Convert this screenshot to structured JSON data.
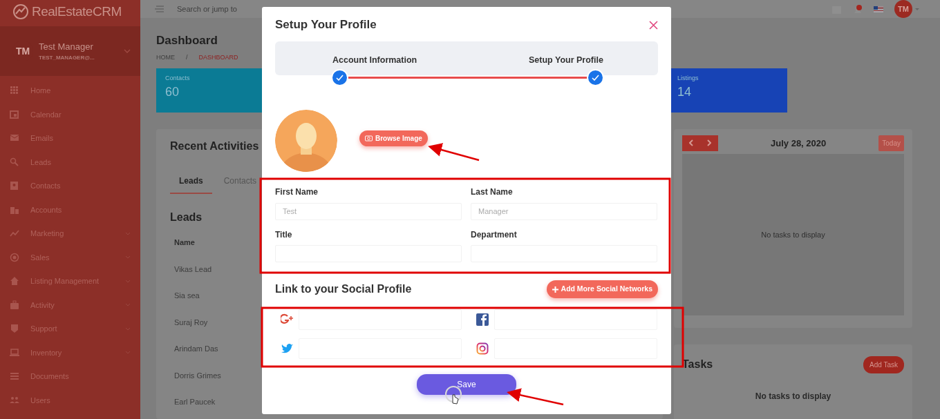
{
  "sidebar": {
    "logo": "RealEstateCRM",
    "user": {
      "initials": "TM",
      "name": "Test Manager",
      "email": "TEST_MANAGER@..."
    },
    "items": [
      {
        "label": "Home",
        "expandable": false
      },
      {
        "label": "Calendar",
        "expandable": false
      },
      {
        "label": "Emails",
        "expandable": false
      },
      {
        "label": "Leads",
        "expandable": false
      },
      {
        "label": "Contacts",
        "expandable": false
      },
      {
        "label": "Accounts",
        "expandable": false
      },
      {
        "label": "Marketing",
        "expandable": true
      },
      {
        "label": "Sales",
        "expandable": true
      },
      {
        "label": "Listing Management",
        "expandable": true
      },
      {
        "label": "Activity",
        "expandable": true
      },
      {
        "label": "Support",
        "expandable": true
      },
      {
        "label": "Inventory",
        "expandable": true
      },
      {
        "label": "Documents",
        "expandable": false
      },
      {
        "label": "Users",
        "expandable": false
      }
    ]
  },
  "topbar": {
    "search": {
      "placeholder": "Search or jump to"
    },
    "avatar": "TM"
  },
  "page": {
    "title": "Dashboard",
    "breadcrumb": [
      "HOME",
      "DASHBOARD"
    ],
    "breadcrumb_separator": "/",
    "stats": [
      {
        "label": "Contacts",
        "value": "60",
        "color": "#0b7b95"
      },
      {
        "label": "Listings",
        "value": "14",
        "color": "#1743b5"
      }
    ]
  },
  "activities": {
    "title": "Recent Activities",
    "tabs": [
      {
        "label": "Leads",
        "selected": true
      },
      {
        "label": "Contacts",
        "selected": false
      }
    ],
    "section": "Leads",
    "column": "Name",
    "rows": [
      "Vikas Lead",
      "Sia sea",
      "Suraj Roy",
      "Arindam Das",
      "Dorris Grimes",
      "Earl Paucek"
    ]
  },
  "calendar": {
    "date": "July 28, 2020",
    "today_button": "Today",
    "empty": "No tasks to display"
  },
  "tasks": {
    "title": "Tasks",
    "button": "Add Task",
    "empty": "No tasks to display"
  },
  "modal": {
    "title": "Setup Your Profile",
    "steps": [
      {
        "label": "Account Information",
        "done": true
      },
      {
        "label": "Setup Your Profile",
        "done": true
      }
    ],
    "browse_button": "Browse Image",
    "fields": [
      {
        "label": "First Name",
        "placeholder": "Test"
      },
      {
        "label": "Last Name",
        "placeholder": "Manager"
      },
      {
        "label": "Title"
      },
      {
        "label": "Department"
      }
    ],
    "social_title": "Link to your Social Profile",
    "add_social_button": "Add More Social Networks",
    "save_button": "Save"
  }
}
